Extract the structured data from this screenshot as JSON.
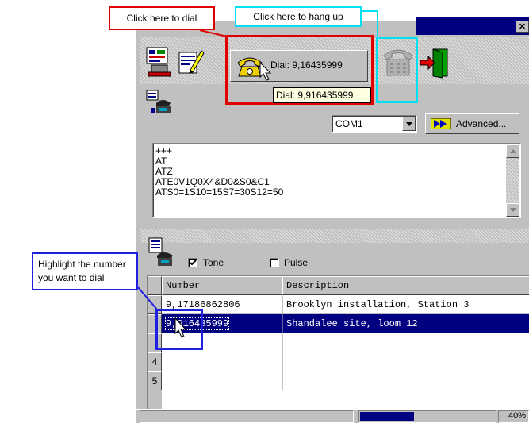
{
  "callouts": {
    "dial": "Click here to dial",
    "hangup": "Click here to hang up",
    "highlight": "Highlight the number you want to dial"
  },
  "title_bar": {
    "close_label": "✕"
  },
  "toolbar": {
    "dial_button_label": "Dial: 9,16435999",
    "tooltip": "Dial: 9,916435999"
  },
  "modem": {
    "port_value": "COM1",
    "advanced_label": "Advanced...",
    "log_lines": [
      "+++",
      "AT",
      "ATZ",
      "ATE0V1Q0X4&D0&S0&C1",
      "ATS0=1S10=15S7=30S12=50"
    ]
  },
  "dial_mode": {
    "tone_label": "Tone",
    "tone_checked": true,
    "pulse_label": "Pulse",
    "pulse_checked": false
  },
  "table": {
    "columns": [
      "Number",
      "Description"
    ],
    "rows": [
      {
        "num": "",
        "number": "9,17186862806",
        "description": "Brooklyn installation, Station 3",
        "selected": false
      },
      {
        "num": "",
        "number": "9,916435999",
        "description": "Shandalee site, loom 12",
        "selected": true
      },
      {
        "num": "",
        "number": "",
        "description": "",
        "selected": false
      },
      {
        "num": "4",
        "number": "",
        "description": "",
        "selected": false
      },
      {
        "num": "5",
        "number": "",
        "description": "",
        "selected": false
      }
    ]
  },
  "status": {
    "progress_percent": 40,
    "progress_text": "40%"
  },
  "colors": {
    "red": "#e00000",
    "cyan": "#00e0f0",
    "blue": "#2020e0",
    "selection": "#000080"
  }
}
